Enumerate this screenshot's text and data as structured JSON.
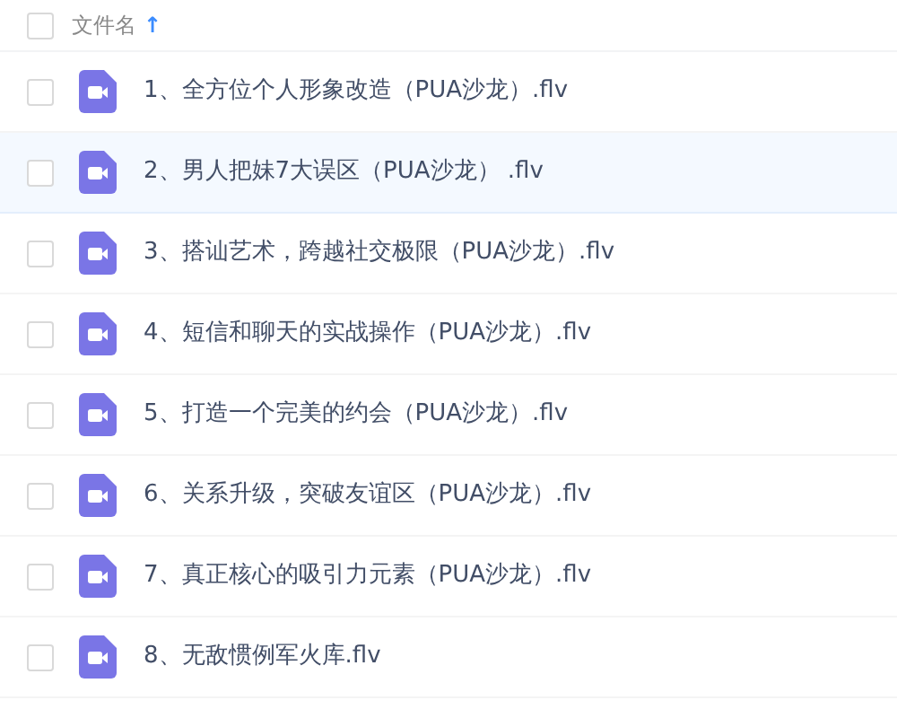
{
  "header": {
    "checked": false,
    "label": "文件名",
    "sort_icon": "↑"
  },
  "rows": [
    {
      "name": "1、全方位个人形象改造（PUA沙龙）.flv",
      "checked": false,
      "selected": false
    },
    {
      "name": "2、男人把妹7大误区（PUA沙龙） .flv",
      "checked": false,
      "selected": true
    },
    {
      "name": "3、搭讪艺术，跨越社交极限（PUA沙龙）.flv",
      "checked": false,
      "selected": false
    },
    {
      "name": "4、短信和聊天的实战操作（PUA沙龙）.flv",
      "checked": false,
      "selected": false
    },
    {
      "name": "5、打造一个完美的约会（PUA沙龙）.flv",
      "checked": false,
      "selected": false
    },
    {
      "name": "6、关系升级，突破友谊区（PUA沙龙）.flv",
      "checked": false,
      "selected": false
    },
    {
      "name": "7、真正核心的吸引力元素（PUA沙龙）.flv",
      "checked": false,
      "selected": false
    },
    {
      "name": "8、无敌惯例军火库.flv",
      "checked": false,
      "selected": false
    }
  ]
}
